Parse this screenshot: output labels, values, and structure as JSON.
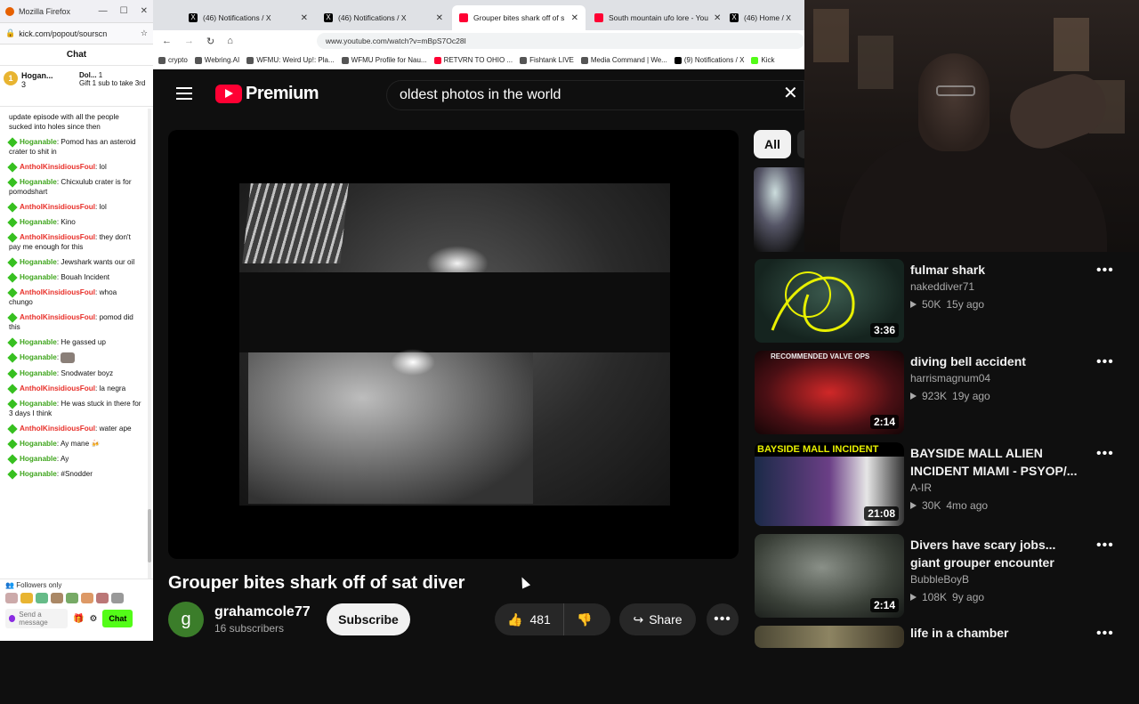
{
  "chat_window": {
    "browser_title": "Mozilla Firefox",
    "url": "kick.com/popout/sourscn",
    "header": "Chat",
    "pinned": {
      "user1_name": "Hogan...",
      "user1_count": "3",
      "user2_name": "Dol...",
      "user2_count": "1",
      "user2_note": "Gift 1 sub to take 3rd"
    },
    "messages": [
      {
        "user": "",
        "text": "update episode with all the people sucked into holes since then",
        "color": "g"
      },
      {
        "user": "Hoganable",
        "text": ": Pomod has an asteroid crater to shit in",
        "color": "g"
      },
      {
        "user": "AntholKinsidiousFoul",
        "text": ": lol",
        "color": "r"
      },
      {
        "user": "Hoganable",
        "text": ": Chicxulub crater is for pomodshart",
        "color": "g"
      },
      {
        "user": "AntholKinsidiousFoul",
        "text": ": lol",
        "color": "r"
      },
      {
        "user": "Hoganable",
        "text": ": Kino",
        "color": "g"
      },
      {
        "user": "AntholKinsidiousFoul",
        "text": ": they don't pay me enough for this",
        "color": "r"
      },
      {
        "user": "Hoganable",
        "text": ": Jewshark wants our oil",
        "color": "g"
      },
      {
        "user": "Hoganable",
        "text": ": Bouah Incident",
        "color": "g"
      },
      {
        "user": "AntholKinsidiousFoul",
        "text": ": whoa chungo",
        "color": "r"
      },
      {
        "user": "AntholKinsidiousFoul",
        "text": ": pomod did this",
        "color": "r"
      },
      {
        "user": "Hoganable",
        "text": ": He gassed up",
        "color": "g"
      },
      {
        "user": "Hoganable",
        "text": ":",
        "color": "g"
      },
      {
        "user": "Hoganable",
        "text": ": Snodwater boyz",
        "color": "g"
      },
      {
        "user": "AntholKinsidiousFoul",
        "text": ": la negra",
        "color": "r"
      },
      {
        "user": "Hoganable",
        "text": ": He was stuck in there for 3 days I think",
        "color": "g"
      },
      {
        "user": "AntholKinsidiousFoul",
        "text": ": water ape",
        "color": "r"
      },
      {
        "user": "Hoganable",
        "text": ": Ay mane",
        "color": "g"
      },
      {
        "user": "Hoganable",
        "text": ": Ay",
        "color": "g"
      },
      {
        "user": "Hoganable",
        "text": ": #Snodder",
        "color": "g"
      }
    ],
    "followers_only": "Followers only",
    "send_placeholder": "Send a message",
    "chat_button": "Chat"
  },
  "browser": {
    "tabs": [
      {
        "label": "(46) Notifications / X",
        "icon_color": "#000000",
        "active": false
      },
      {
        "label": "(46) Notifications / X",
        "icon_color": "#000000",
        "active": false
      },
      {
        "label": "Grouper bites shark off of s",
        "icon_color": "#ff0033",
        "active": true
      },
      {
        "label": "South mountain ufo lore - You",
        "icon_color": "#ff0033",
        "active": false
      },
      {
        "label": "(46) Home / X",
        "icon_color": "#000000",
        "active": false
      }
    ],
    "url": "www.youtube.com/watch?v=mBpS7Oc28I",
    "bookmarks": [
      "crypto",
      "Webring.AI",
      "WFMU: Weird Up!: Pla...",
      "WFMU Profile for Nau...",
      "RETVRN TO OHIO ...",
      "Fishtank LIVE",
      "Media Command | We...",
      "(9) Notifications / X",
      "Kick"
    ]
  },
  "youtube": {
    "logo_text": "Premium",
    "search_value": "oldest photos in the world",
    "video_title": "Grouper bites shark off of sat diver",
    "channel_initial": "g",
    "channel_name": "grahamcole77",
    "subscriber_count": "16 subscribers",
    "subscribe_label": "Subscribe",
    "like_count": "481",
    "share_label": "Share",
    "chip_all": "All",
    "recommendations": [
      {
        "title": "fulmar shark",
        "channel": "nakeddiver71",
        "views": "50K",
        "age": "15y ago",
        "duration": "3:36",
        "thumb": "#1d3a33"
      },
      {
        "title": "diving bell accident",
        "channel": "harrismagnum04",
        "views": "923K",
        "age": "19y ago",
        "duration": "2:14",
        "thumb": "#5a1b1b",
        "overlay": "RECOMMENDED VALVE OPS"
      },
      {
        "title": "BAYSIDE MALL ALIEN INCIDENT MIAMI - PSYOP/...",
        "channel": "A-IR",
        "views": "30K",
        "age": "4mo ago",
        "duration": "21:08",
        "thumb": "#2c2740",
        "overlay": "BAYSIDE MALL INCIDENT"
      },
      {
        "title": "Divers have scary jobs... giant grouper encounter",
        "channel": "BubbleBoyB",
        "views": "108K",
        "age": "9y ago",
        "duration": "2:14",
        "thumb": "#3f4640"
      },
      {
        "title": "life in a chamber",
        "channel": "",
        "views": "",
        "age": "",
        "duration": "",
        "thumb": "#3b3526"
      }
    ]
  }
}
